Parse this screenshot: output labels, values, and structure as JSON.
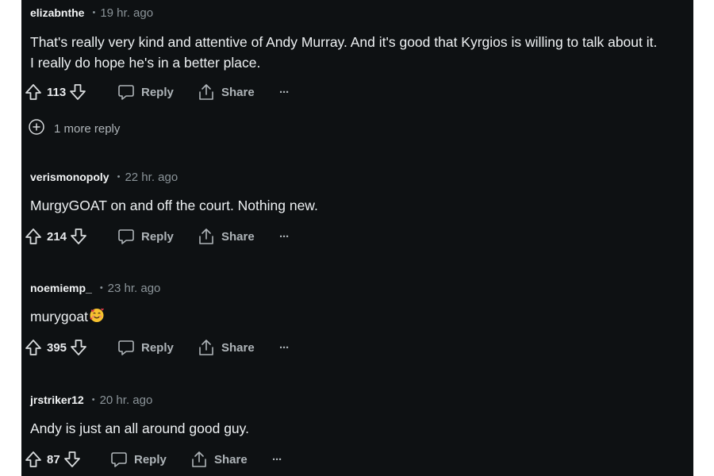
{
  "comments": [
    {
      "author": "elizabnthe",
      "time": "19 hr. ago",
      "text_line1": "That's really very kind and attentive of Andy Murray. And it's good that Kyrgios is willing to talk about it.",
      "text_line2": "I really do hope he's in a better place.",
      "votes": "113",
      "more_replies": "1 more reply"
    },
    {
      "author": "verismonopoly",
      "time": "22 hr. ago",
      "text_line1": "MurgyGOAT on and off the court. Nothing new.",
      "votes": "214"
    },
    {
      "author": "noemiemp_",
      "time": "23 hr. ago",
      "text_line1": "murygoat",
      "emoji": "smiling-face-with-hearts",
      "votes": "395"
    },
    {
      "author": "jrstriker12",
      "time": "20 hr. ago",
      "text_line1": "Andy is just an all around good guy.",
      "votes": "87"
    }
  ],
  "actions": {
    "reply_label": "Reply",
    "share_label": "Share",
    "overflow_label": "···"
  },
  "icons": [
    "upvote-icon",
    "downvote-icon",
    "reply-icon",
    "share-icon",
    "overflow-menu-icon",
    "expand-replies-icon"
  ],
  "colors": {
    "background": "#0e1113",
    "text": "#eef1f3",
    "muted": "#8b9499"
  }
}
